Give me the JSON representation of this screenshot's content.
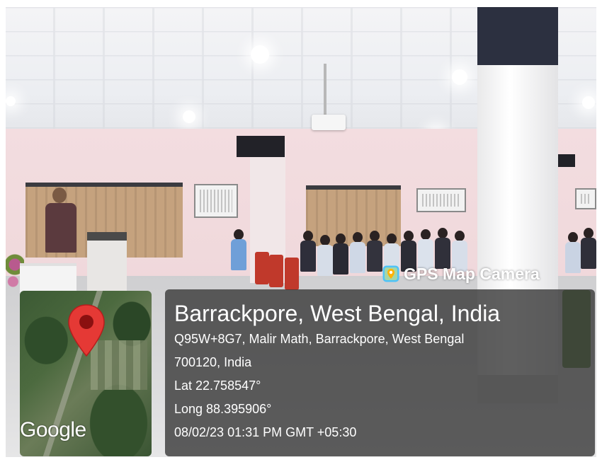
{
  "badge": {
    "app_name": "GPS Map Camera",
    "icon": "map-pin-app-icon"
  },
  "map": {
    "provider_label": "Google",
    "pin_icon": "location-pin-icon",
    "pin_color": "#e53935"
  },
  "location": {
    "title": "Barrackpore, West Bengal, India",
    "address_line1": "Q95W+8G7, Malir Math, Barrackpore, West Bengal",
    "address_line2": "700120, India",
    "latitude": "Lat 22.758547°",
    "longitude": "Long 88.395906°",
    "timestamp": "08/02/23 01:31 PM GMT +05:30"
  },
  "colors": {
    "panel": "#3c3c3c",
    "text": "#ffffff"
  }
}
